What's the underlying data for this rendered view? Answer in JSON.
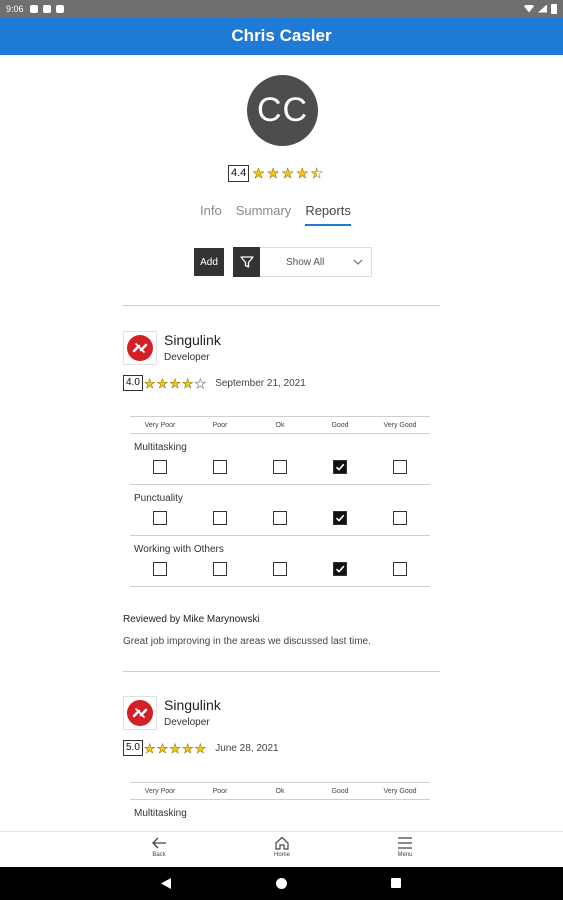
{
  "status_bar": {
    "time": "9:06"
  },
  "header": {
    "title": "Chris Casler"
  },
  "profile": {
    "initials": "CC",
    "rating": "4.4",
    "stars": 4.4
  },
  "tabs": [
    {
      "label": "Info",
      "active": false
    },
    {
      "label": "Summary",
      "active": false
    },
    {
      "label": "Reports",
      "active": true
    }
  ],
  "toolbar": {
    "add_label": "Add",
    "filter_value": "Show All"
  },
  "grid_columns": [
    "Very Poor",
    "Poor",
    "Ok",
    "Good",
    "Very Good"
  ],
  "reports": [
    {
      "company": "Singulink",
      "role": "Developer",
      "rating": "4.0",
      "stars": 4,
      "date": "September 21, 2021",
      "criteria": [
        {
          "label": "Multitasking",
          "selected": 3
        },
        {
          "label": "Punctuality",
          "selected": 3
        },
        {
          "label": "Working with Others",
          "selected": 3
        }
      ],
      "reviewer": "Reviewed by Mike Marynowski",
      "comment": "Great job improving in the areas we discussed last time."
    },
    {
      "company": "Singulink",
      "role": "Developer",
      "rating": "5.0",
      "stars": 5,
      "date": "June 28, 2021",
      "criteria": [
        {
          "label": "Multitasking",
          "selected": null
        }
      ]
    }
  ],
  "bottom_nav": {
    "back_label": "Back",
    "home_label": "Home",
    "menu_label": "Menu"
  },
  "colors": {
    "primary": "#1f7ad6",
    "avatar_bg": "#4d4d4d",
    "star": "#f5c518",
    "logo_red": "#d32027"
  }
}
